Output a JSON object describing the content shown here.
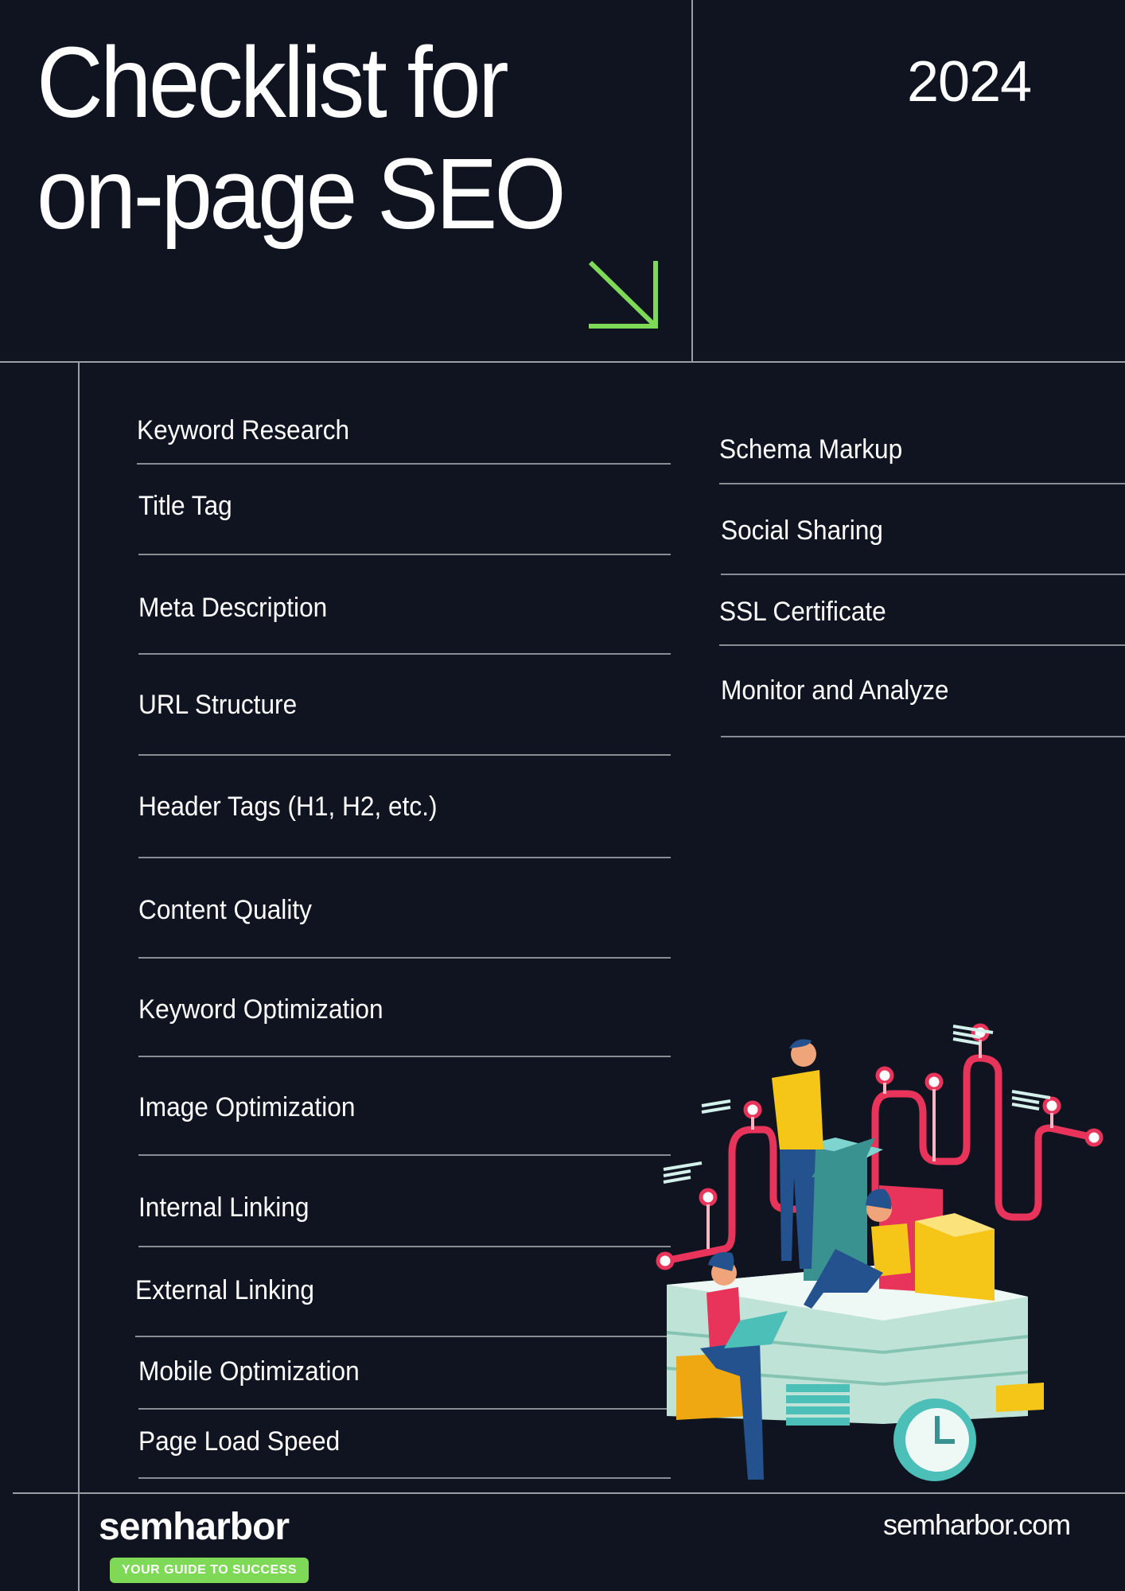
{
  "header": {
    "title_line1": "Checklist for",
    "title_line2": "on-page SEO",
    "year": "2024"
  },
  "checklist": {
    "left": [
      "Keyword Research",
      "Title Tag",
      "Meta Description",
      "URL Structure",
      "Header Tags (H1, H2, etc.)",
      "Content Quality",
      "Keyword Optimization",
      "Image Optimization",
      "Internal Linking",
      "External Linking",
      "Mobile Optimization",
      "Page Load Speed"
    ],
    "right": [
      "Schema Markup",
      "Social Sharing",
      "SSL Certificate",
      "Monitor and Analyze"
    ]
  },
  "footer": {
    "brand": "semharbor",
    "tagline": "YOUR GUIDE TO SUCCESS",
    "website": "semharbor.com"
  },
  "colors": {
    "background": "#0f1420",
    "accent_green": "#7ed957",
    "rule": "#9a9da3",
    "illustration_red": "#e8345a",
    "illustration_teal": "#4bbfb8",
    "illustration_yellow": "#f5c518"
  }
}
